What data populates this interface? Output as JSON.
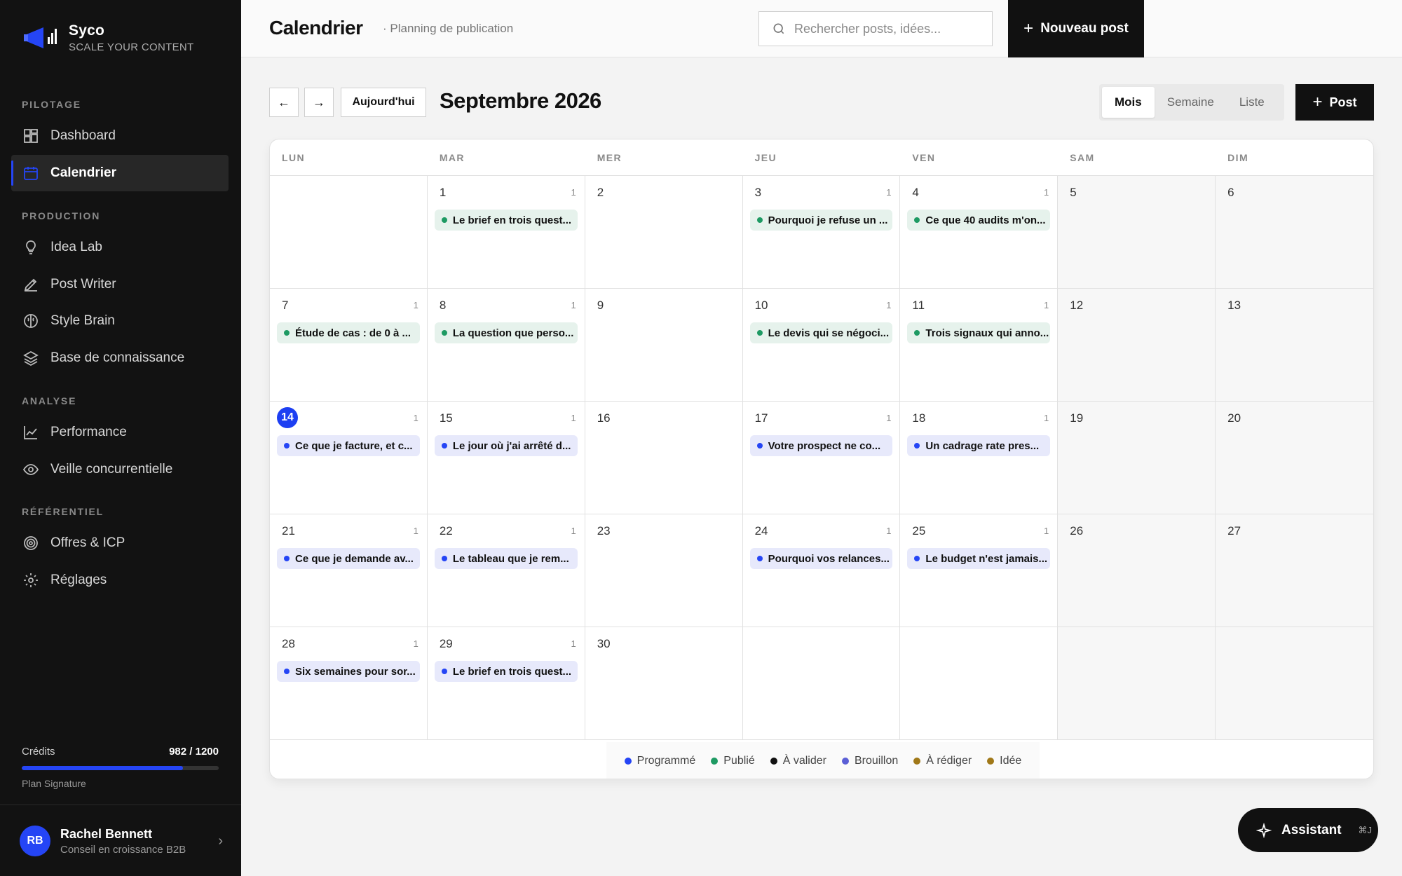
{
  "brand": {
    "name": "Syco",
    "tagline": "SCALE YOUR CONTENT"
  },
  "sidebar": {
    "sections": [
      "PILOTAGE",
      "PRODUCTION",
      "ANALYSE",
      "RÉFÉRENTIEL"
    ],
    "items": [
      {
        "label": "Dashboard",
        "icon": "dashboard-icon"
      },
      {
        "label": "Calendrier",
        "icon": "calendar-icon",
        "active": true
      },
      {
        "label": "Idea Lab",
        "icon": "lightbulb-icon"
      },
      {
        "label": "Post Writer",
        "icon": "pen-icon"
      },
      {
        "label": "Style Brain",
        "icon": "brain-icon"
      },
      {
        "label": "Base de connaissance",
        "icon": "layers-icon"
      },
      {
        "label": "Performance",
        "icon": "chart-line-icon"
      },
      {
        "label": "Veille concurrentielle",
        "icon": "eye-icon"
      },
      {
        "label": "Offres & ICP",
        "icon": "target-icon"
      },
      {
        "label": "Réglages",
        "icon": "gear-icon"
      }
    ],
    "credits": {
      "label": "Crédits",
      "value": "982 / 1200",
      "used_fraction": 0.818
    },
    "plan": "Plan Signature",
    "user": {
      "initials": "RB",
      "name": "Rachel Bennett",
      "role": "Conseil en croissance B2B"
    }
  },
  "header": {
    "title": "Calendrier",
    "subtitle": "· Planning de publication",
    "search_placeholder": "Rechercher posts, idées...",
    "new_post": "Nouveau post"
  },
  "toolbar": {
    "prev": "←",
    "next": "→",
    "today": "Aujourd'hui",
    "month": "Septembre 2026",
    "views": [
      "Mois",
      "Semaine",
      "Liste"
    ],
    "active_view": "Mois",
    "post": "Post"
  },
  "calendar": {
    "weekdays": [
      "LUN",
      "MAR",
      "MER",
      "JEU",
      "VEN",
      "SAM",
      "DIM"
    ],
    "today": "14",
    "cells": [
      {
        "day": "",
        "count": "",
        "event": null
      },
      {
        "day": "1",
        "count": "1",
        "event": {
          "title": "Le brief en trois quest...",
          "status": "pub"
        }
      },
      {
        "day": "2",
        "count": "",
        "event": null
      },
      {
        "day": "3",
        "count": "1",
        "event": {
          "title": "Pourquoi je refuse un ...",
          "status": "pub"
        }
      },
      {
        "day": "4",
        "count": "1",
        "event": {
          "title": "Ce que 40 audits m'on...",
          "status": "pub"
        }
      },
      {
        "day": "5",
        "count": "",
        "event": null
      },
      {
        "day": "6",
        "count": "",
        "event": null
      },
      {
        "day": "7",
        "count": "1",
        "event": {
          "title": "Étude de cas : de 0 à ...",
          "status": "pub"
        }
      },
      {
        "day": "8",
        "count": "1",
        "event": {
          "title": "La question que perso...",
          "status": "pub"
        }
      },
      {
        "day": "9",
        "count": "",
        "event": null
      },
      {
        "day": "10",
        "count": "1",
        "event": {
          "title": "Le devis qui se négoci...",
          "status": "pub"
        }
      },
      {
        "day": "11",
        "count": "1",
        "event": {
          "title": "Trois signaux qui anno...",
          "status": "pub"
        }
      },
      {
        "day": "12",
        "count": "",
        "event": null
      },
      {
        "day": "13",
        "count": "",
        "event": null
      },
      {
        "day": "14",
        "count": "1",
        "event": {
          "title": "Ce que je facture, et c...",
          "status": "prog"
        }
      },
      {
        "day": "15",
        "count": "1",
        "event": {
          "title": "Le jour où j'ai arrêté d...",
          "status": "prog"
        }
      },
      {
        "day": "16",
        "count": "",
        "event": null
      },
      {
        "day": "17",
        "count": "1",
        "event": {
          "title": "Votre prospect ne co...",
          "status": "prog"
        }
      },
      {
        "day": "18",
        "count": "1",
        "event": {
          "title": "Un cadrage rate pres...",
          "status": "prog"
        }
      },
      {
        "day": "19",
        "count": "",
        "event": null
      },
      {
        "day": "20",
        "count": "",
        "event": null
      },
      {
        "day": "21",
        "count": "1",
        "event": {
          "title": "Ce que je demande av...",
          "status": "prog"
        }
      },
      {
        "day": "22",
        "count": "1",
        "event": {
          "title": "Le tableau que je rem...",
          "status": "prog"
        }
      },
      {
        "day": "23",
        "count": "",
        "event": null
      },
      {
        "day": "24",
        "count": "1",
        "event": {
          "title": "Pourquoi vos relances...",
          "status": "prog"
        }
      },
      {
        "day": "25",
        "count": "1",
        "event": {
          "title": "Le budget n'est jamais...",
          "status": "prog"
        }
      },
      {
        "day": "26",
        "count": "",
        "event": null
      },
      {
        "day": "27",
        "count": "",
        "event": null
      },
      {
        "day": "28",
        "count": "1",
        "event": {
          "title": "Six semaines pour sor...",
          "status": "prog"
        }
      },
      {
        "day": "29",
        "count": "1",
        "event": {
          "title": "Le brief en trois quest...",
          "status": "prog"
        }
      },
      {
        "day": "30",
        "count": "",
        "event": null
      },
      {
        "day": "",
        "count": "",
        "event": null
      },
      {
        "day": "",
        "count": "",
        "event": null
      },
      {
        "day": "",
        "count": "",
        "event": null
      },
      {
        "day": "",
        "count": "",
        "event": null
      }
    ]
  },
  "legend": [
    {
      "label": "Programmé",
      "color": "#2545f5"
    },
    {
      "label": "Publié",
      "color": "#1e9a63"
    },
    {
      "label": "À valider",
      "color": "#111111"
    },
    {
      "label": "Brouillon",
      "color": "#5b5fd6"
    },
    {
      "label": "À rédiger",
      "color": "#a07818"
    },
    {
      "label": "Idée",
      "color": "#a07818"
    }
  ],
  "assistant": {
    "label": "Assistant",
    "shortcut": "⌘J"
  }
}
